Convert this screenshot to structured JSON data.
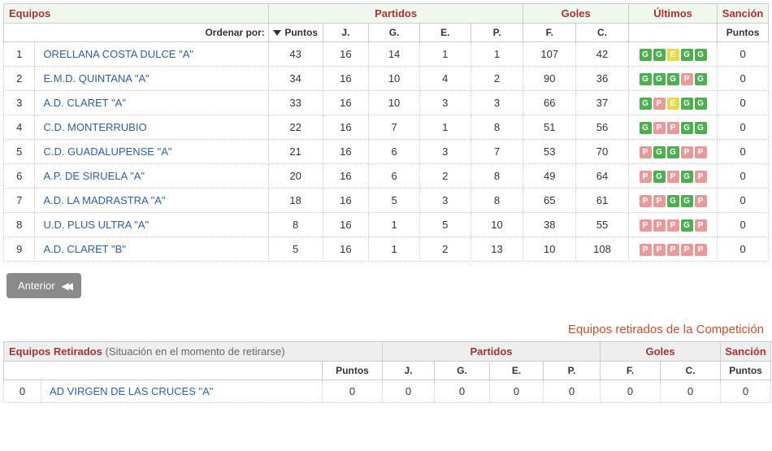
{
  "main": {
    "headers": {
      "equipos": "Equipos",
      "partidos": "Partidos",
      "goles": "Goles",
      "ultimos": "Últimos",
      "sancion": "Sanción"
    },
    "sort": {
      "label": "Ordenar por:",
      "value": "Puntos"
    },
    "cols": {
      "j": "J.",
      "g": "G.",
      "e": "E.",
      "p": "P.",
      "f": "F.",
      "c": "C.",
      "san": "Puntos"
    },
    "rows": [
      {
        "pos": 1,
        "team": "ORELLANA COSTA DULCE \"A\"",
        "pts": 43,
        "j": 16,
        "g": 14,
        "e": 1,
        "p": 1,
        "f": 107,
        "c": 42,
        "ult": [
          "G",
          "G",
          "E",
          "G",
          "G"
        ],
        "san": 0
      },
      {
        "pos": 2,
        "team": "E.M.D. QUINTANA \"A\"",
        "pts": 34,
        "j": 16,
        "g": 10,
        "e": 4,
        "p": 2,
        "f": 90,
        "c": 36,
        "ult": [
          "G",
          "G",
          "G",
          "P",
          "G"
        ],
        "san": 0
      },
      {
        "pos": 3,
        "team": "A.D. CLARET \"A\"",
        "pts": 33,
        "j": 16,
        "g": 10,
        "e": 3,
        "p": 3,
        "f": 66,
        "c": 37,
        "ult": [
          "G",
          "P",
          "E",
          "G",
          "G"
        ],
        "san": 0
      },
      {
        "pos": 4,
        "team": "C.D. MONTERRUBIO",
        "pts": 22,
        "j": 16,
        "g": 7,
        "e": 1,
        "p": 8,
        "f": 51,
        "c": 56,
        "ult": [
          "G",
          "P",
          "P",
          "G",
          "G"
        ],
        "san": 0
      },
      {
        "pos": 5,
        "team": "C.D. GUADALUPENSE \"A\"",
        "pts": 21,
        "j": 16,
        "g": 6,
        "e": 3,
        "p": 7,
        "f": 53,
        "c": 70,
        "ult": [
          "P",
          "G",
          "G",
          "P",
          "P"
        ],
        "san": 0
      },
      {
        "pos": 6,
        "team": "A.P. DE SIRUELA \"A\"",
        "pts": 20,
        "j": 16,
        "g": 6,
        "e": 2,
        "p": 8,
        "f": 49,
        "c": 64,
        "ult": [
          "P",
          "G",
          "P",
          "G",
          "P"
        ],
        "san": 0
      },
      {
        "pos": 7,
        "team": "A.D. LA MADRASTRA \"A\"",
        "pts": 18,
        "j": 16,
        "g": 5,
        "e": 3,
        "p": 8,
        "f": 65,
        "c": 61,
        "ult": [
          "P",
          "P",
          "G",
          "G",
          "P"
        ],
        "san": 0
      },
      {
        "pos": 8,
        "team": "U.D. PLUS ULTRA \"A\"",
        "pts": 8,
        "j": 16,
        "g": 1,
        "e": 5,
        "p": 10,
        "f": 38,
        "c": 55,
        "ult": [
          "P",
          "P",
          "P",
          "G",
          "P"
        ],
        "san": 0
      },
      {
        "pos": 9,
        "team": "A.D. CLARET \"B\"",
        "pts": 5,
        "j": 16,
        "g": 1,
        "e": 2,
        "p": 13,
        "f": 10,
        "c": 108,
        "ult": [
          "P",
          "P",
          "P",
          "P",
          "P"
        ],
        "san": 0
      }
    ]
  },
  "prev_button": "Anterior",
  "retired": {
    "title": "Equipos retirados de la Competición",
    "header_label": "Equipos Retirados",
    "header_sub": "(Situación en el momento de retirarse)",
    "headers": {
      "partidos": "Partidos",
      "goles": "Goles",
      "sancion": "Sanción"
    },
    "cols": {
      "pts": "Puntos",
      "j": "J.",
      "g": "G.",
      "e": "E.",
      "p": "P.",
      "f": "F.",
      "c": "C.",
      "san": "Puntos"
    },
    "rows": [
      {
        "pos": 0,
        "team": "AD VIRGEN DE LAS CRUCES \"A\"",
        "pts": 0,
        "j": 0,
        "g": 0,
        "e": 0,
        "p": 0,
        "f": 0,
        "c": 0,
        "san": 0
      }
    ]
  }
}
